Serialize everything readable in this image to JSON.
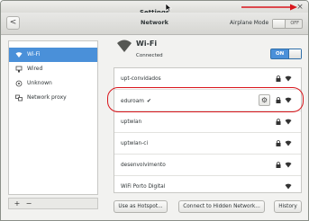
{
  "window": {
    "title": "Settings"
  },
  "header": {
    "title": "Network",
    "back_label": "<",
    "airplane_label": "Airplane Mode",
    "airplane_state": "OFF",
    "close_label": "×"
  },
  "sidebar": {
    "items": [
      {
        "label": "Wi-Fi",
        "icon": "wifi-icon",
        "active": true
      },
      {
        "label": "Wired",
        "icon": "wired-icon",
        "active": false
      },
      {
        "label": "Unknown",
        "icon": "unknown-device-icon",
        "active": false
      },
      {
        "label": "Network proxy",
        "icon": "proxy-icon",
        "active": false
      }
    ],
    "add_label": "+",
    "remove_label": "−"
  },
  "wifi": {
    "title": "Wi-Fi",
    "status": "Connected",
    "switch_state": "ON"
  },
  "networks": [
    {
      "name": "upt-convidados",
      "secured": true,
      "connected": false
    },
    {
      "name": "eduroam",
      "secured": true,
      "connected": true,
      "check": "✔"
    },
    {
      "name": "uptwlan",
      "secured": true,
      "connected": false
    },
    {
      "name": "uptwlan-ci",
      "secured": true,
      "connected": false
    },
    {
      "name": "desenvolvimento",
      "secured": true,
      "connected": false
    },
    {
      "name": "WiFi Porto Digital",
      "secured": false,
      "connected": false
    }
  ],
  "buttons": {
    "hotspot": "Use as Hotspot...",
    "hidden": "Connect to Hidden Network...",
    "history": "History"
  },
  "annotation": {
    "color": "#d9161c"
  },
  "colors": {
    "accent": "#4a90d9"
  }
}
